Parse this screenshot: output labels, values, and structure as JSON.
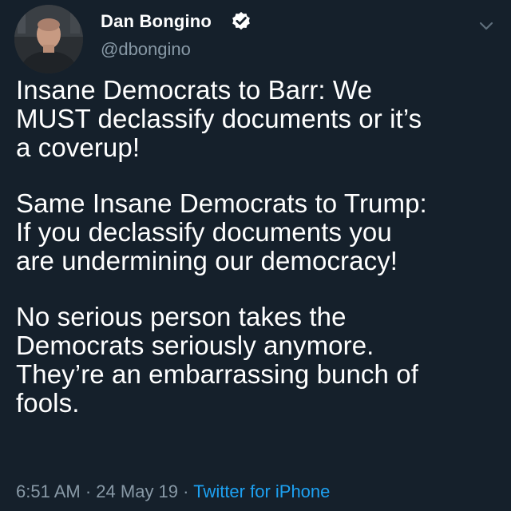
{
  "author": {
    "display_name": "Dan Bongino",
    "handle": "@dbongino",
    "verified": true,
    "verified_icon": "verified-badge-icon",
    "avatar_icon": "profile-photo"
  },
  "menu": {
    "icon": "chevron-down-icon"
  },
  "tweet": {
    "lines": [
      "Insane Democrats to Barr: We",
      "MUST declassify documents or it’s",
      "a coverup!",
      "Same Insane Democrats to Trump:",
      "If you declassify documents you",
      "are undermining our democracy!",
      "No serious person takes the",
      "Democrats seriously anymore.",
      "They’re an embarrassing bunch of",
      "fools."
    ],
    "time": "6:51 AM",
    "date": "24 May 19",
    "separator": "·",
    "source": "Twitter for iPhone"
  },
  "colors": {
    "background": "#15202b",
    "text": "#ffffff",
    "secondary_text": "#8899a6",
    "link": "#1da1f2"
  }
}
